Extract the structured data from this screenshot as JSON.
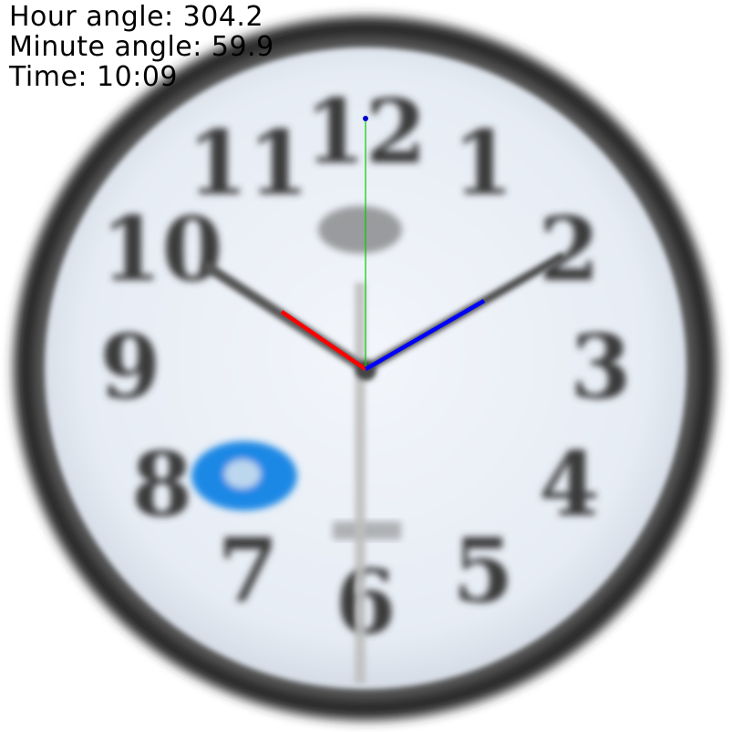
{
  "overlay": {
    "hour_angle_label": "Hour angle: 304.2",
    "minute_angle_label": "Minute angle: 59.9",
    "time_label": "Time: 10:09"
  },
  "clock": {
    "numerals": [
      "12",
      "1",
      "2",
      "3",
      "4",
      "5",
      "6",
      "7",
      "8",
      "9",
      "10",
      "11"
    ],
    "hour_angle_deg": 304.2,
    "minute_angle_deg": 59.9,
    "colors": {
      "rim": "#1a1a1a",
      "face": "#e9eef5",
      "numeral": "#3a3a3a",
      "hour_marker": "#ff0000",
      "minute_marker": "#0000ff",
      "reference_line": "#00cc00",
      "reference_dot": "#0000cc",
      "logo_badge": "#1e88e5"
    }
  }
}
